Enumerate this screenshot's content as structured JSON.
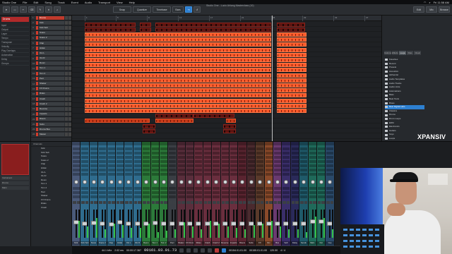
{
  "menubar": {
    "items": [
      "Studio One",
      "File",
      "Edit",
      "Song",
      "Track",
      "Event",
      "Audio",
      "Transport",
      "View",
      "Help"
    ],
    "clock": "Fri 11:58 AM"
  },
  "window": {
    "title": "Studio One - Lucio Ahlang Masterclass (10)"
  },
  "toolbar": {
    "tools": [
      "Snap",
      "Quantize",
      "Timebase",
      "Bars",
      "Follow",
      "Edit",
      "Mix",
      "Browse"
    ]
  },
  "inspector": {
    "header": "Drums",
    "rows": [
      "Input",
      "Output",
      "Layer",
      "Tempo",
      "Transpose",
      "Velocity",
      "Play Overlaps",
      "Automation",
      "Delay",
      "Groups"
    ]
  },
  "tracks": [
    {
      "num": "1",
      "name": "Drums"
    },
    {
      "num": "2",
      "name": "Kick"
    },
    {
      "num": "3",
      "name": "Kick Sub"
    },
    {
      "num": "4",
      "name": "Snare"
    },
    {
      "num": "5",
      "name": "Snare 2"
    },
    {
      "num": "6",
      "name": "Clap"
    },
    {
      "num": "7",
      "name": "HiHat"
    },
    {
      "num": "8",
      "name": "OH L"
    },
    {
      "num": "9",
      "name": "OH R"
    },
    {
      "num": "10",
      "name": "Room"
    },
    {
      "num": "11",
      "name": "Tom 1"
    },
    {
      "num": "12",
      "name": "Tom 2"
    },
    {
      "num": "13",
      "name": "Perc"
    },
    {
      "num": "14",
      "name": "Shaker"
    },
    {
      "num": "15",
      "name": "FX Drums"
    },
    {
      "num": "16",
      "name": "Rides"
    },
    {
      "num": "17",
      "name": "Crash"
    },
    {
      "num": "18",
      "name": "Crash 2"
    },
    {
      "num": "19",
      "name": "Reverse"
    },
    {
      "num": "20",
      "name": "Impacts"
    },
    {
      "num": "21",
      "name": "Risers"
    },
    {
      "num": "22",
      "name": "Subs"
    },
    {
      "num": "23",
      "name": "Drums Bus"
    },
    {
      "num": "24",
      "name": "Master"
    }
  ],
  "ruler": {
    "labels": [
      "1",
      "5",
      "9",
      "13",
      "17",
      "21",
      "25",
      "29",
      "33",
      "37"
    ]
  },
  "browser": {
    "tabs": [
      "Instruments",
      "Effects",
      "Loops",
      "Files",
      "Cloud"
    ],
    "items": [
      "Favorites",
      "Recent",
      "Presets",
      "Acoustics",
      "Alchemist",
      "Audio Templates",
      "Audio Tracks",
      "Audio Units",
      "Automations",
      "Bass",
      "Beat Tools",
      "Brass",
      "Best Digital Labs",
      "Classics",
      "Drums",
      "Drum Loops",
      "EDM",
      "Electronics",
      "Guitars",
      "Keys",
      "Loops",
      "Multi",
      "Orchestral",
      "Pads",
      "Percussion",
      "Pianos",
      "Strings",
      "Synths",
      "Vocals",
      "Vintage",
      "World"
    ],
    "selected_index": 12
  },
  "watermark": {
    "brand": "XPANSIV",
    "tagline": ""
  },
  "mixer": {
    "left_labels": [
      "Instrument",
      "Drums",
      "Main"
    ],
    "list_header": "Channels",
    "list": [
      "Kick",
      "Kick Sub",
      "Snare",
      "Snare 2",
      "Clap",
      "HiHat",
      "OH L",
      "OH R",
      "Room",
      "Tom 1",
      "Tom 2",
      "Perc",
      "Shaker",
      "FX Drums",
      "Rides",
      "Crash"
    ],
    "strips": [
      {
        "name": "Kick",
        "color": "#4a5a7a",
        "level": 0.55,
        "meter": 0.6
      },
      {
        "name": "Kick Sub",
        "color": "#2f6c8e",
        "level": 0.5,
        "meter": 0.4
      },
      {
        "name": "Snare",
        "color": "#2f6c8e",
        "level": 0.52,
        "meter": 0.7
      },
      {
        "name": "Snare 2",
        "color": "#2f6c8e",
        "level": 0.5,
        "meter": 0.3
      },
      {
        "name": "Clap",
        "color": "#2f6c8e",
        "level": 0.48,
        "meter": 0.5
      },
      {
        "name": "HiHat",
        "color": "#2f6c8e",
        "level": 0.55,
        "meter": 0.45
      },
      {
        "name": "OH L",
        "color": "#2f6c8e",
        "level": 0.5,
        "meter": 0.35
      },
      {
        "name": "OH R",
        "color": "#2f6c8e",
        "level": 0.5,
        "meter": 0.35
      },
      {
        "name": "Room",
        "color": "#2c7a3a",
        "level": 0.5,
        "meter": 0.5
      },
      {
        "name": "Tom 1",
        "color": "#2c7a3a",
        "level": 0.52,
        "meter": 0.2
      },
      {
        "name": "Tom 2",
        "color": "#2c7a3a",
        "level": 0.5,
        "meter": 0.25
      },
      {
        "name": "Perc",
        "color": "#3a3e44",
        "level": 0.5,
        "meter": 0.3
      },
      {
        "name": "Shaker",
        "color": "#5a2e3c",
        "level": 0.5,
        "meter": 0.55
      },
      {
        "name": "FX Drums",
        "color": "#5a2e3c",
        "level": 0.5,
        "meter": 0.4
      },
      {
        "name": "Rides",
        "color": "#6a2e3e",
        "level": 0.5,
        "meter": 0.3
      },
      {
        "name": "Crash",
        "color": "#6a2e3e",
        "level": 0.5,
        "meter": 0.6
      },
      {
        "name": "Crash 2",
        "color": "#6a2e3e",
        "level": 0.5,
        "meter": 0.5
      },
      {
        "name": "Reverse",
        "color": "#6a2e3e",
        "level": 0.5,
        "meter": 0.4
      },
      {
        "name": "Impacts",
        "color": "#6a2e3e",
        "level": 0.5,
        "meter": 0.35
      },
      {
        "name": "Risers",
        "color": "#5a2430",
        "level": 0.5,
        "meter": 0.3
      },
      {
        "name": "Subs",
        "color": "#4a2a2e",
        "level": 0.5,
        "meter": 0.45
      },
      {
        "name": "FX",
        "color": "#5a3a2a",
        "level": 0.5,
        "meter": 0.5
      },
      {
        "name": "Vox",
        "color": "#8a4a2a",
        "level": 0.5,
        "meter": 0.6
      },
      {
        "name": "Bus",
        "color": "#6a3a70",
        "level": 0.5,
        "meter": 0.4
      },
      {
        "name": "Verb",
        "color": "#3a2e6a",
        "level": 0.5,
        "meter": 0.3
      },
      {
        "name": "Delay",
        "color": "#2a2a5a",
        "level": 0.5,
        "meter": 0.3
      },
      {
        "name": "Sends",
        "color": "#1f5a6a",
        "level": 0.5,
        "meter": 0.2
      },
      {
        "name": "Main",
        "color": "#1f6a5a",
        "level": 0.6,
        "meter": 0.75
      },
      {
        "name": "Out",
        "color": "#1f6a5a",
        "level": 0.6,
        "meter": 0.7
      },
      {
        "name": "Cue",
        "color": "#2a4a6a",
        "level": 0.5,
        "meter": 0.3
      }
    ]
  },
  "transport": {
    "sample_rate": "44.1 kHz",
    "latency": "2.02 ms",
    "record_time": "00:00:17.367",
    "position": "00161.03.01.73",
    "loop_start": "00154.01.01.00",
    "loop_end": "00155.01.01.00",
    "tempo": "120.00",
    "signature": "4 / 4"
  }
}
